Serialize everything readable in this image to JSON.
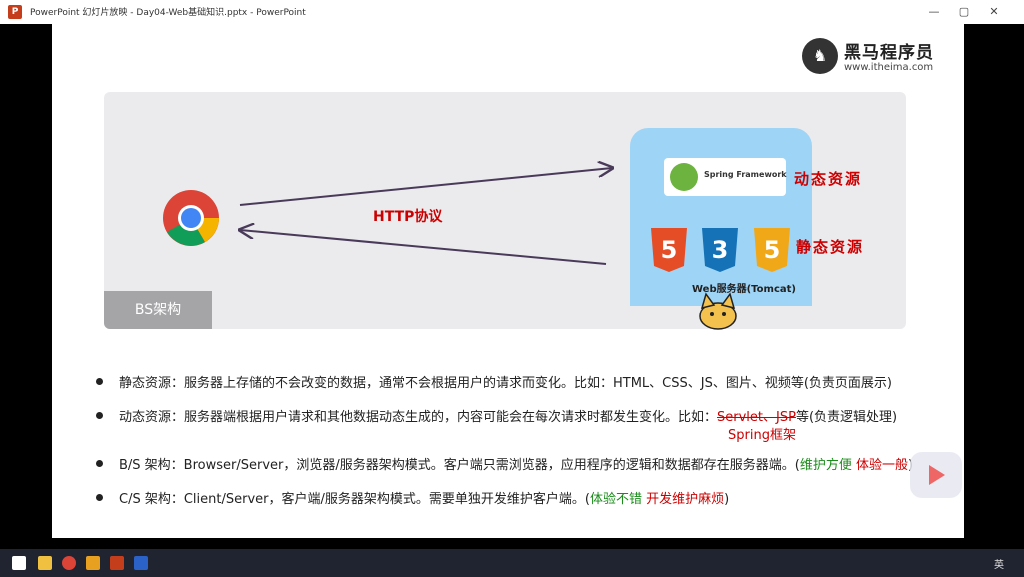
{
  "window": {
    "title": "PowerPoint 幻灯片放映 - Day04-Web基础知识.pptx - PowerPoint",
    "controls": {
      "minimize": "—",
      "restore": "▢",
      "close": "✕"
    }
  },
  "slide": {
    "logo": {
      "name": "黑马程序员",
      "url": "www.itheima.com"
    },
    "diagram": {
      "arch_tag": "BS架构",
      "protocol_label": "HTTP协议",
      "spring_label": "Spring Framework",
      "dynamic_label": "动态资源",
      "static_label": "静态资源",
      "server_label": "Web服务器(Tomcat)",
      "shields": [
        "5",
        "3",
        "5"
      ]
    },
    "bullets": [
      {
        "text": "静态资源：服务器上存储的不会改变的数据，通常不会根据用户的请求而变化。比如：HTML、CSS、JS、图片、视频等(负责页面展示)"
      },
      {
        "prefix": "动态资源：服务器端根据用户请求和其他数据动态生成的，内容可能会在每次请求时都发生变化。比如：",
        "strike": "Servlet、JSP",
        "suffix": "等(负责逻辑处理)"
      },
      {
        "prefix": "B/S 架构：Browser/Server，浏览器/服务器架构模式。客户端只需浏览器，应用程序的逻辑和数据都存在服务器端。(",
        "green": "维护方便",
        "red": "体验一般",
        "suffix": ")"
      },
      {
        "prefix": "C/S 架构：Client/Server，客户端/服务器架构模式。需要单独开发维护客户端。(",
        "green": "体验不错",
        "red": "开发维护麻烦",
        "suffix": ")"
      }
    ],
    "handwritten_note": "Spring框架"
  },
  "taskbar": {
    "ime": "英"
  },
  "colors": {
    "red": "#cc0000",
    "green": "#1a8c1a",
    "panel": "#ebebee",
    "server": "#9ed4f6"
  }
}
